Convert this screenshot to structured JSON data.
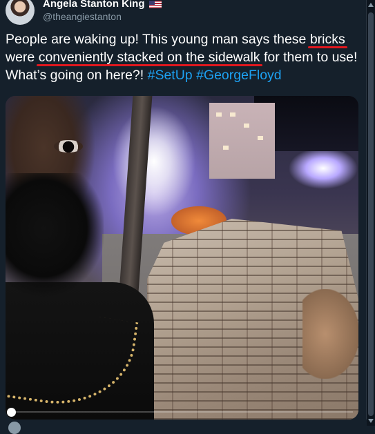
{
  "author": {
    "display_name": "Angela Stanton King",
    "handle": "@theangiestanton",
    "badge_icon": "us-flag-icon"
  },
  "tweet": {
    "segments": [
      {
        "text": "People are waking up! This young man says these ",
        "style": "plain"
      },
      {
        "text": "bricks",
        "style": "underlined"
      },
      {
        "text": " were ",
        "style": "plain"
      },
      {
        "text": "conveniently stacked on the sidewalk",
        "style": "underlined"
      },
      {
        "text": " for them to use! What’s going on here?! ",
        "style": "plain"
      },
      {
        "text": "#SetUp",
        "style": "hashtag"
      },
      {
        "text": " ",
        "style": "plain"
      },
      {
        "text": "#GeorgeFloyd",
        "style": "hashtag"
      }
    ]
  },
  "video": {
    "progress": 0.01
  },
  "colors": {
    "background": "#15202b",
    "text": "#ffffff",
    "secondary": "#8899a6",
    "hashtag": "#1da1f2",
    "annotation": "#e0171e"
  }
}
